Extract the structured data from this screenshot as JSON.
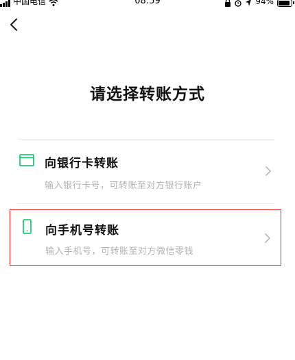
{
  "status_bar": {
    "carrier": "中国电信",
    "time": "08:59",
    "battery": "94%",
    "battery_level": 0.94
  },
  "nav": {
    "back_icon": "chevron-left-icon"
  },
  "page": {
    "title": "请选择转账方式"
  },
  "options": [
    {
      "id": "bank-card",
      "icon": "bank-card-icon",
      "title": "向银行卡转账",
      "description": "输入银行卡号，可转账至对方银行账户",
      "accent_color": "#07c160"
    },
    {
      "id": "phone-number",
      "icon": "mobile-phone-icon",
      "title": "向手机号转账",
      "description": "输入手机号，可转账至对方微信零钱",
      "accent_color": "#07c160",
      "highlight_color": "#e02424"
    }
  ]
}
